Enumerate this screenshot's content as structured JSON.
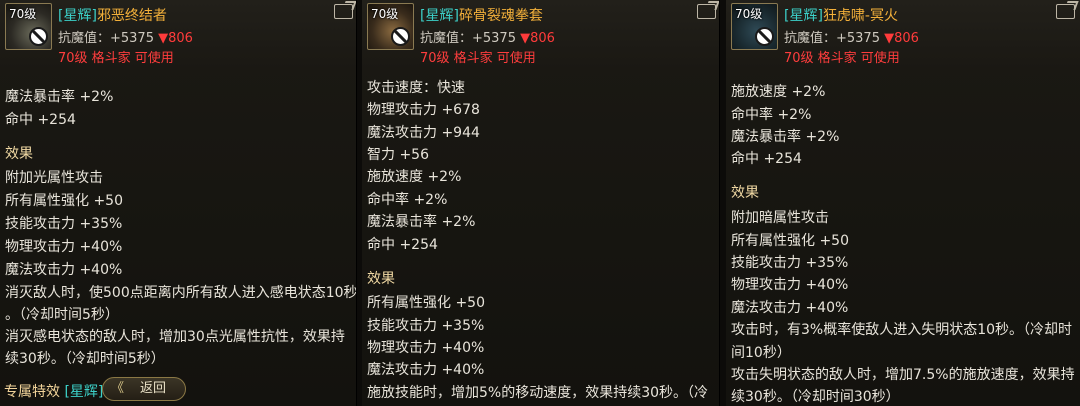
{
  "panels": [
    {
      "level": "70级",
      "tag": "[星辉]",
      "name": "邪恶终结者",
      "resist_label": "抗魔值：+5375",
      "resist_down": "▼806",
      "requirement": "70级 格斗家 可使用",
      "partial_top": "",
      "lines": [
        "魔法暴击率 +2%",
        "命中 +254",
        "效果",
        "附加光属性攻击",
        "所有属性强化 +50",
        "技能攻击力 +35%",
        "物理攻击力 +40%",
        "魔法攻击力 +40%",
        "消灭敌人时，使500点距离内所有敌人进入感电状态10秒",
        "。（冷却时间5秒）",
        "消灭感电状态的敌人时，增加30点光属性抗性，效果持",
        "续30秒。（冷却时间5秒）"
      ],
      "footer_label": "专属特效",
      "footer_tag": "[星辉]",
      "back_button": "返回"
    },
    {
      "level": "70级",
      "tag": "[星辉]",
      "name": "碎骨裂魂拳套",
      "resist_label": "抗魔值：+5375",
      "resist_down": "▼806",
      "requirement": "70级 格斗家 可使用",
      "lines": [
        "攻击速度：快速",
        "物理攻击力 +678",
        "魔法攻击力 +944",
        "智力 +56",
        "施放速度 +2%",
        "命中率 +2%",
        "魔法暴击率 +2%",
        "命中 +254",
        "效果",
        "所有属性强化 +50",
        "技能攻击力 +35%",
        "物理攻击力 +40%",
        "魔法攻击力 +40%",
        "施放技能时，增加5%的移动速度，效果持续30秒。（冷"
      ]
    },
    {
      "level": "70级",
      "tag": "[星辉]",
      "name": "狂虎啸-冥火",
      "resist_label": "抗魔值：+5375",
      "resist_down": "▼806",
      "requirement": "70级 格斗家 可使用",
      "lines": [
        "施放速度 +2%",
        "命中率 +2%",
        "魔法暴击率 +2%",
        "命中 +254",
        "效果",
        "附加暗属性攻击",
        "所有属性强化 +50",
        "技能攻击力 +35%",
        "物理攻击力 +40%",
        "魔法攻击力 +40%",
        "攻击时，有3%概率使敌人进入失明状态10秒。（冷却时",
        "间10秒）",
        "攻击失明状态的敌人时，增加7.5%的施放速度，效果持",
        "续30秒。（冷却时间30秒）"
      ]
    }
  ],
  "icons": {
    "share": "share-icon",
    "no_trade": "ban-icon",
    "back_chevron": "double-chevron-left-icon"
  },
  "colors": {
    "tag": "#3cd0c8",
    "name": "#f3b03a",
    "requirement": "#ff3d3d",
    "section": "#f1d9a4"
  }
}
